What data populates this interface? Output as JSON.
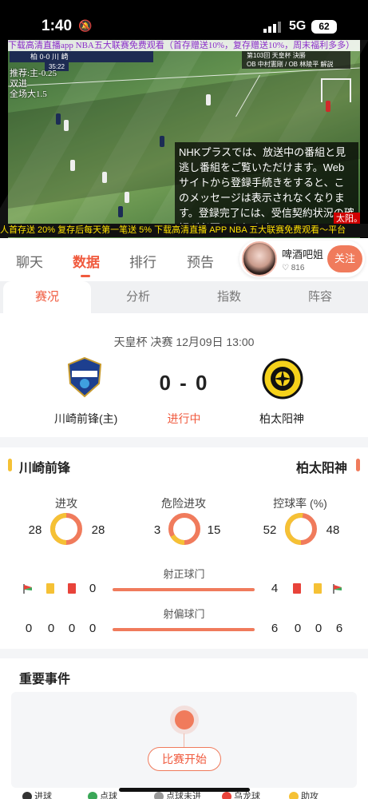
{
  "status_bar": {
    "time": "1:40",
    "network": "5G",
    "battery": "62"
  },
  "video": {
    "top_banner": "下载高清直播app NBA五大联赛免费观看（首存赠送10%，复存赠送10%，周末福利多多）",
    "scorebug": "柏 0-0 川 崎",
    "scorebug_time": "35:22",
    "tv_info_line1": "第103回 天皇杯 決勝",
    "tv_info_line2": "OB 中村憲剛 / OB 林陵平 解説",
    "odds": [
      "推荐:主-0.25",
      "双进",
      "全场大1.5"
    ],
    "nhk_text": "NHKプラスでは、放送中の番組と見逃し番組をご覧いただけます。Webサイトから登録手続きをすると、このメッセージは表示されなくなります。登録完了には、受信契約状況の確認が必要になります。",
    "ticker": "人首存送 20% 复存后每天第一笔送 5% 下载高清直播 APP NBA 五大联赛免费观看～平台",
    "ticker_tag": "太阳。白"
  },
  "tabs": [
    {
      "label": "聊天",
      "active": false
    },
    {
      "label": "数据",
      "active": true
    },
    {
      "label": "排行",
      "active": false
    },
    {
      "label": "预告",
      "active": false
    }
  ],
  "anchor": {
    "name": "啤酒吧姐",
    "fans": "♡ 816",
    "follow": "关注"
  },
  "subtabs": [
    {
      "label": "赛况",
      "active": true
    },
    {
      "label": "分析",
      "active": false
    },
    {
      "label": "指数",
      "active": false
    },
    {
      "label": "阵容",
      "active": false
    }
  ],
  "match": {
    "info": "天皇杯 决赛  12月09日 13:00",
    "home": "川崎前锋(主)",
    "away": "柏太阳神",
    "score": "0 - 0",
    "status": "进行中"
  },
  "stats": {
    "home_team": "川崎前锋",
    "away_team": "柏太阳神",
    "attack": {
      "label": "进攻",
      "home": "28",
      "away": "28",
      "home_share": 0.5
    },
    "dangerous": {
      "label": "危险进攻",
      "home": "3",
      "away": "15",
      "home_share": 0.167
    },
    "possession": {
      "label": "控球率 (%)",
      "home": "52",
      "away": "48",
      "home_share": 0.52
    },
    "shots_on": {
      "label": "射正球门",
      "home": "0",
      "away": "4"
    },
    "shots_off": {
      "label": "射偏球门",
      "home": "0",
      "away": "6"
    },
    "home_corners": "0",
    "home_yellow": "0",
    "home_red": "0",
    "away_corners": "6",
    "away_yellow": "0",
    "away_red": "0"
  },
  "events": {
    "title": "重要事件",
    "start": "比赛开始"
  },
  "legend": [
    "进球",
    "点球",
    "点球未进",
    "乌龙球",
    "助攻"
  ],
  "colors": {
    "accent": "#f05a3e",
    "home": "#f5c135",
    "away": "#f07b5c"
  }
}
